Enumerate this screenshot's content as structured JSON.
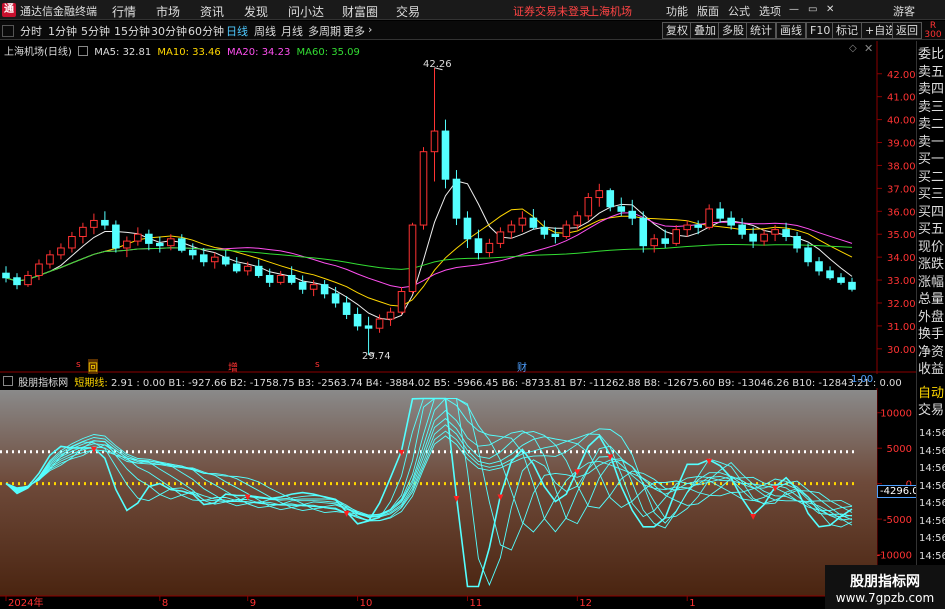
{
  "menubar": {
    "app_title": "通达信金融终端",
    "items": [
      "行情",
      "市场",
      "资讯",
      "发现",
      "问小达",
      "财富圈",
      "交易"
    ],
    "notice": "证券交易未登录",
    "stock_name": "上海机场",
    "right_items": [
      "功能",
      "版面",
      "公式",
      "选项"
    ],
    "user": "游客"
  },
  "toolbar": {
    "periods": [
      "分时",
      "1分钟",
      "5分钟",
      "15分钟",
      "30分钟",
      "60分钟",
      "日线",
      "周线",
      "月线",
      "多周期",
      "更多"
    ],
    "active": "日线",
    "right_buttons": [
      "复权",
      "叠加",
      "多股",
      "统计",
      "画线",
      "F10",
      "标记",
      "+自选",
      "返回"
    ]
  },
  "chart_header": {
    "title": "上海机场(日线)",
    "ma5": "MA5: 32.81",
    "ma10": "MA10: 33.46",
    "ma20": "MA20: 34.23",
    "ma60": "MA60: 35.09"
  },
  "annotations": {
    "high": "42.26",
    "low": "29.74",
    "badge_r": "R",
    "badge_num": "300"
  },
  "event_markers": [
    "回",
    "增",
    "财"
  ],
  "indicator": {
    "name": "股朋指标网",
    "sub": "短期线:",
    "values": "2.91 : 0.00  B1: -927.66  B2: -1758.75  B3: -2563.74  B4: -3884.02  B5: -5966.45  B6: -8733.81  B7: -11262.88  B8: -12675.60  B9: -13046.26  B10: -12843.21  : 0.00",
    "scale": "1.00",
    "current": "-4296.00"
  },
  "sidebar": {
    "top": [
      "委比",
      "卖五",
      "卖四",
      "卖三",
      "卖二",
      "卖一",
      "买一",
      "买二",
      "买三",
      "买四",
      "买五",
      "现价",
      "涨跌",
      "涨幅",
      "总量",
      "外盘",
      "换手",
      "净资",
      "收益"
    ],
    "bottom": [
      "自动",
      "交易"
    ],
    "times": [
      "14:56",
      "14:56",
      "14:56",
      "14:56",
      "14:56",
      "14:56",
      "14:56",
      "14:56",
      "14:56"
    ]
  },
  "xaxis": [
    "2024年",
    "8",
    "9",
    "10",
    "11",
    "12",
    "1"
  ],
  "watermark": {
    "title": "股朋指标网",
    "url": "www.7gpzb.com"
  },
  "chart_data": [
    {
      "type": "candlestick",
      "title": "上海机场(日线)",
      "yaxis": {
        "ticks": [
          42,
          41,
          40,
          39,
          38,
          37,
          36,
          35,
          34,
          33,
          32,
          31,
          30
        ],
        "range": [
          29.5,
          42.6
        ]
      },
      "ohlc": [
        [
          33.3,
          33.6,
          32.9,
          33.1
        ],
        [
          33.1,
          33.3,
          32.6,
          32.8
        ],
        [
          32.8,
          33.4,
          32.7,
          33.2
        ],
        [
          33.2,
          33.9,
          33.0,
          33.7
        ],
        [
          33.7,
          34.3,
          33.5,
          34.1
        ],
        [
          34.1,
          34.6,
          33.9,
          34.4
        ],
        [
          34.4,
          35.1,
          34.2,
          34.9
        ],
        [
          34.9,
          35.5,
          34.6,
          35.3
        ],
        [
          35.3,
          35.9,
          35.0,
          35.6
        ],
        [
          35.6,
          36.0,
          35.2,
          35.4
        ],
        [
          35.4,
          35.6,
          34.2,
          34.4
        ],
        [
          34.4,
          34.9,
          34.0,
          34.7
        ],
        [
          34.7,
          35.3,
          34.5,
          35.0
        ],
        [
          35.0,
          35.2,
          34.3,
          34.6
        ],
        [
          34.6,
          34.9,
          34.2,
          34.5
        ],
        [
          34.5,
          35.0,
          34.3,
          34.8
        ],
        [
          34.8,
          35.0,
          34.2,
          34.3
        ],
        [
          34.3,
          34.6,
          33.9,
          34.1
        ],
        [
          34.1,
          34.4,
          33.6,
          33.8
        ],
        [
          33.8,
          34.2,
          33.5,
          34.0
        ],
        [
          34.0,
          34.3,
          33.6,
          33.7
        ],
        [
          33.7,
          34.0,
          33.3,
          33.4
        ],
        [
          33.4,
          33.8,
          33.2,
          33.6
        ],
        [
          33.6,
          33.9,
          33.1,
          33.2
        ],
        [
          33.2,
          33.5,
          32.7,
          32.9
        ],
        [
          32.9,
          33.4,
          32.8,
          33.2
        ],
        [
          33.2,
          33.6,
          32.8,
          32.9
        ],
        [
          32.9,
          33.2,
          32.4,
          32.6
        ],
        [
          32.6,
          33.0,
          32.3,
          32.8
        ],
        [
          32.8,
          33.0,
          32.2,
          32.4
        ],
        [
          32.4,
          32.7,
          31.8,
          32.0
        ],
        [
          32.0,
          32.3,
          31.3,
          31.5
        ],
        [
          31.5,
          31.8,
          30.8,
          31.0
        ],
        [
          31.0,
          31.4,
          29.74,
          30.9
        ],
        [
          30.9,
          31.5,
          30.7,
          31.3
        ],
        [
          31.3,
          31.8,
          31.0,
          31.6
        ],
        [
          31.6,
          32.7,
          31.5,
          32.5
        ],
        [
          32.5,
          35.5,
          32.4,
          35.4
        ],
        [
          35.4,
          38.8,
          35.2,
          38.6
        ],
        [
          38.6,
          42.26,
          37.3,
          39.5
        ],
        [
          39.5,
          40.0,
          37.0,
          37.4
        ],
        [
          37.4,
          37.8,
          35.4,
          35.7
        ],
        [
          35.7,
          36.0,
          34.4,
          34.8
        ],
        [
          34.8,
          35.2,
          33.9,
          34.2
        ],
        [
          34.2,
          34.8,
          34.0,
          34.6
        ],
        [
          34.6,
          35.3,
          34.4,
          35.1
        ],
        [
          35.1,
          35.6,
          34.8,
          35.4
        ],
        [
          35.4,
          36.0,
          35.1,
          35.7
        ],
        [
          35.7,
          36.1,
          35.2,
          35.3
        ],
        [
          35.3,
          35.6,
          34.8,
          35.0
        ],
        [
          35.0,
          35.3,
          34.6,
          34.9
        ],
        [
          34.9,
          35.6,
          34.8,
          35.4
        ],
        [
          35.4,
          36.0,
          35.2,
          35.8
        ],
        [
          35.8,
          36.8,
          35.6,
          36.6
        ],
        [
          36.6,
          37.2,
          36.2,
          36.9
        ],
        [
          36.9,
          37.0,
          36.0,
          36.2
        ],
        [
          36.2,
          36.6,
          35.8,
          36.0
        ],
        [
          36.0,
          36.5,
          35.4,
          35.7
        ],
        [
          35.7,
          36.0,
          34.2,
          34.5
        ],
        [
          34.5,
          35.0,
          34.2,
          34.8
        ],
        [
          34.8,
          35.2,
          34.4,
          34.6
        ],
        [
          34.6,
          35.4,
          34.5,
          35.2
        ],
        [
          35.2,
          35.6,
          34.9,
          35.4
        ],
        [
          35.4,
          35.6,
          35.0,
          35.3
        ],
        [
          35.3,
          36.3,
          35.2,
          36.1
        ],
        [
          36.1,
          36.4,
          35.5,
          35.7
        ],
        [
          35.7,
          36.0,
          35.2,
          35.4
        ],
        [
          35.4,
          35.7,
          34.8,
          35.0
        ],
        [
          35.0,
          35.3,
          34.4,
          34.7
        ],
        [
          34.7,
          35.2,
          34.5,
          35.0
        ],
        [
          35.0,
          35.4,
          34.7,
          35.2
        ],
        [
          35.2,
          35.5,
          34.7,
          34.9
        ],
        [
          34.9,
          35.1,
          34.2,
          34.4
        ],
        [
          34.4,
          34.6,
          33.6,
          33.8
        ],
        [
          33.8,
          34.0,
          33.2,
          33.4
        ],
        [
          33.4,
          33.6,
          33.0,
          33.1
        ],
        [
          33.1,
          33.3,
          32.8,
          32.9
        ],
        [
          32.9,
          33.1,
          32.5,
          32.6
        ]
      ]
    },
    {
      "type": "line",
      "title": "股朋指标网",
      "yaxis": {
        "ticks": [
          10000,
          5000,
          0,
          -5000,
          -10000
        ],
        "range": [
          -15000,
          12500
        ]
      },
      "thresholds": [
        4500,
        0
      ]
    }
  ]
}
